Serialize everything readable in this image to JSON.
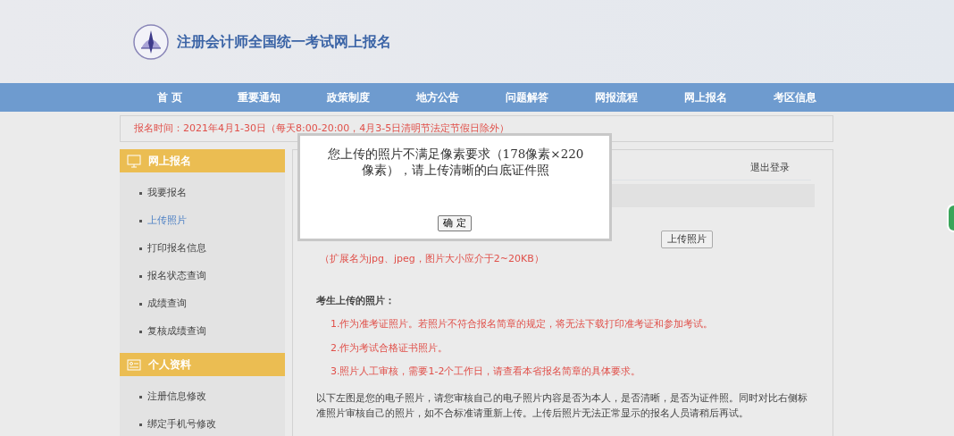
{
  "header": {
    "title": "注册会计师全国统一考试网上报名"
  },
  "nav": [
    {
      "label": "首 页"
    },
    {
      "label": "重要通知"
    },
    {
      "label": "政策制度"
    },
    {
      "label": "地方公告"
    },
    {
      "label": "问题解答"
    },
    {
      "label": "网报流程"
    },
    {
      "label": "网上报名"
    },
    {
      "label": "考区信息"
    }
  ],
  "notice": "报名时间：2021年4月1-30日（每天8:00-20:00，4月3-5日清明节法定节假日除外）",
  "sidebar": [
    {
      "title": "网上报名",
      "kind": "monitor",
      "items": [
        {
          "label": "我要报名",
          "selected": false
        },
        {
          "label": "上传照片",
          "selected": true
        },
        {
          "label": "打印报名信息",
          "selected": false
        },
        {
          "label": "报名状态查询",
          "selected": false
        },
        {
          "label": "成绩查询",
          "selected": false
        },
        {
          "label": "复核成绩查询",
          "selected": false
        }
      ]
    },
    {
      "title": "个人资料",
      "kind": "card",
      "items": [
        {
          "label": "注册信息修改",
          "selected": false
        },
        {
          "label": "绑定手机号修改",
          "selected": false
        }
      ]
    }
  ],
  "main": {
    "logout": "退出登录",
    "upload_button": "上传照片",
    "hint": "（扩展名为jpg、jpeg，图片大小应介于2~20KB）",
    "photos_heading": "考生上传的照片：",
    "rules": [
      "1.作为准考证照片。若照片不符合报名简章的规定，将无法下载打印准考证和参加考试。",
      "2.作为考试合格证书照片。",
      "3.照片人工审核，需要1-2个工作日，请查看本省报名简章的具体要求。"
    ],
    "note": "以下左图是您的电子照片，请您审核自己的电子照片内容是否为本人，是否清晰，是否为证件照。同时对比右侧标准照片审核自己的照片，如不合标准请重新上传。上传后照片无法正常显示的报名人员请稍后再试。"
  },
  "dialog": {
    "message": "您上传的照片不满足像素要求（178像素×220像素），请上传清晰的白底证件照",
    "button": "确 定"
  }
}
